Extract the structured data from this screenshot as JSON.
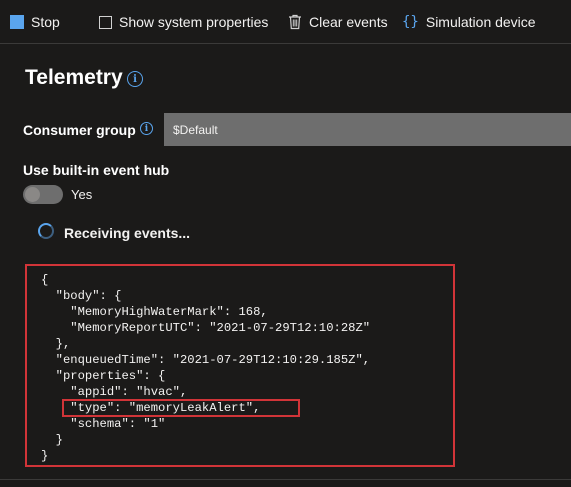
{
  "toolbar": {
    "stop_label": "Stop",
    "show_props_label": "Show system properties",
    "clear_label": "Clear events",
    "simulation_label": "Simulation device"
  },
  "telemetry": {
    "title": "Telemetry"
  },
  "consumer_group": {
    "label": "Consumer group",
    "value": "$Default"
  },
  "event_hub": {
    "label": "Use built-in event hub",
    "toggle_state": "Yes"
  },
  "status": {
    "text": "Receiving events..."
  },
  "json_event": {
    "lines": [
      "{",
      "  \"body\": {",
      "    \"MemoryHighWaterMark\": 168,",
      "    \"MemoryReportUTC\": \"2021-07-29T12:10:28Z\"",
      "  },",
      "  \"enqueuedTime\": \"2021-07-29T12:10:29.185Z\",",
      "  \"properties\": {",
      "    \"appid\": \"hvac\",",
      "    \"type\": \"memoryLeakAlert\",",
      "    \"schema\": \"1\"",
      "  }",
      "}"
    ]
  },
  "colors": {
    "accent": "#5aa5ee",
    "highlight_border": "#d13438",
    "background": "#1b1a19"
  },
  "icons": {
    "stop": "stop-square-icon",
    "checkbox": "checkbox-icon",
    "clear": "trash-icon",
    "simulation": "braces-icon",
    "info": "info-icon"
  }
}
